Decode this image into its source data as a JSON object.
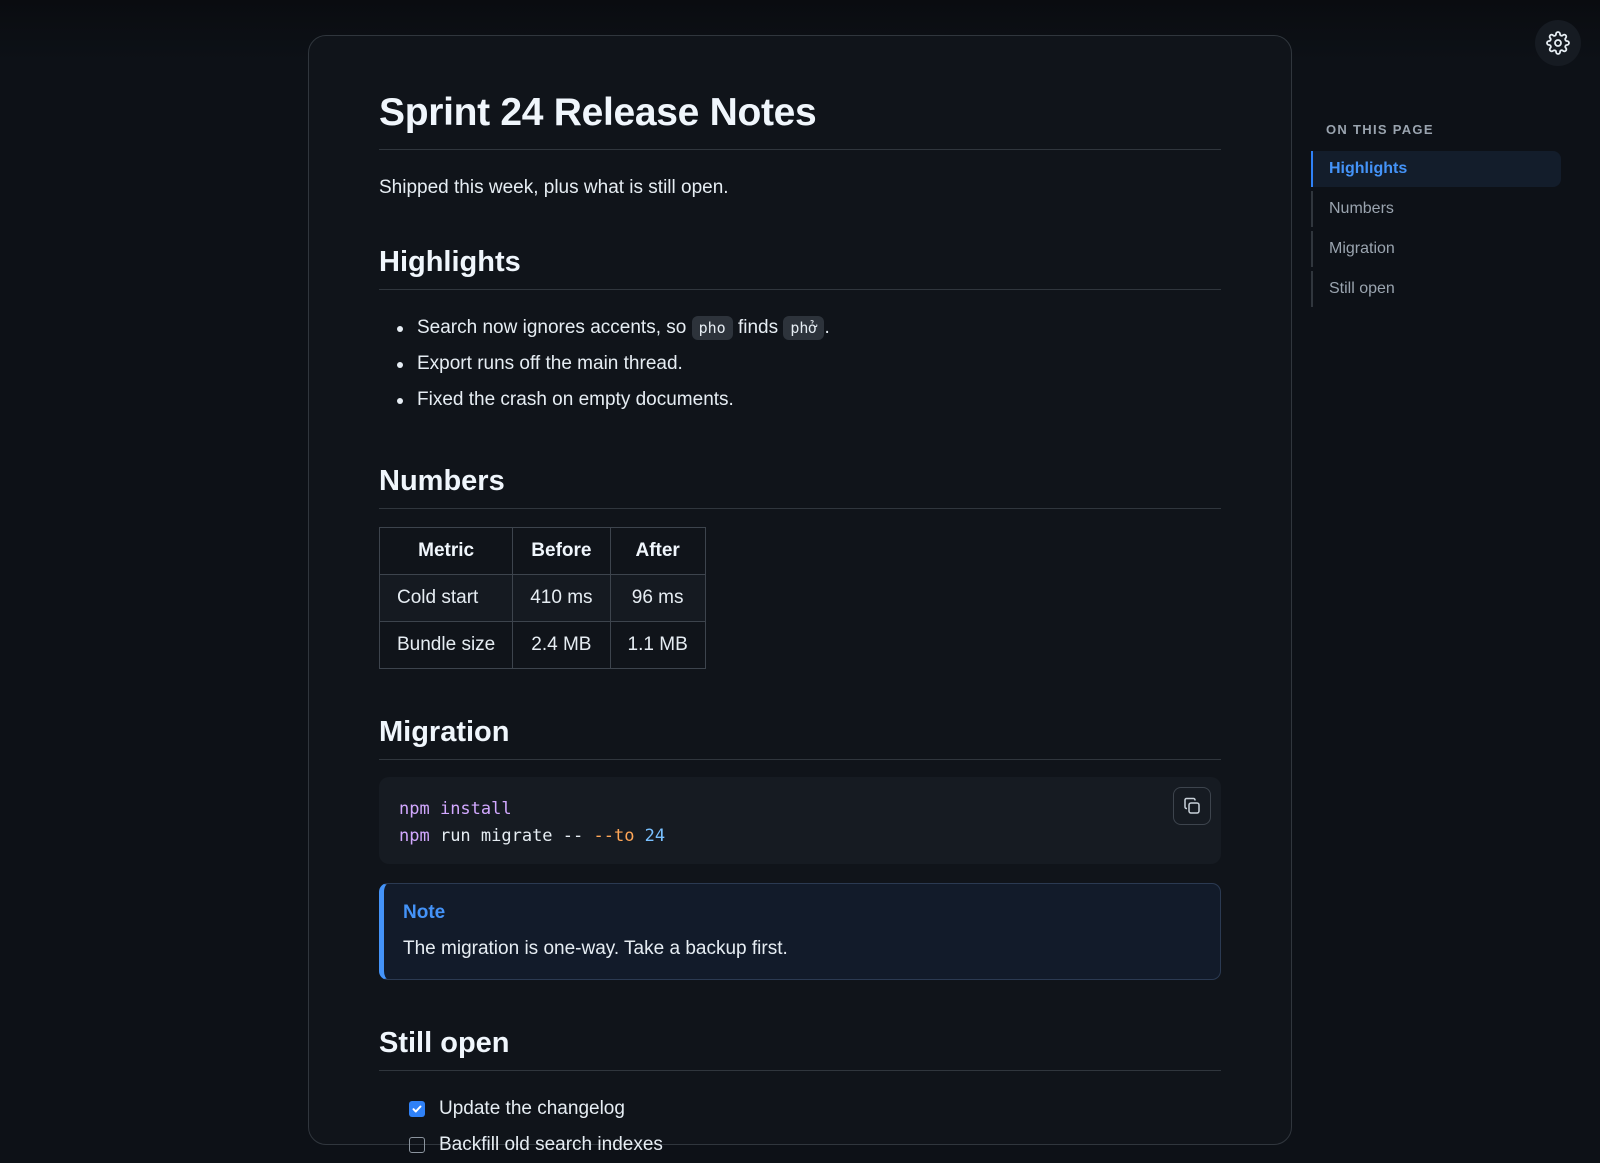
{
  "document": {
    "title": "Sprint 24 Release Notes",
    "lead": "Shipped this week, plus what is still open.",
    "sections": {
      "highlights": {
        "heading": "Highlights",
        "bullet1": {
          "before": "Search now ignores accents, so ",
          "code1": "pho",
          "middle": " finds ",
          "code2": "phở",
          "after": "."
        },
        "bullet2": "Export runs off the main thread.",
        "bullet3": "Fixed the crash on empty documents."
      },
      "numbers": {
        "heading": "Numbers",
        "table": {
          "headers": [
            "Metric",
            "Before",
            "After"
          ],
          "rows": [
            [
              "Cold start",
              "410 ms",
              "96 ms"
            ],
            [
              "Bundle size",
              "2.4 MB",
              "1.1 MB"
            ]
          ]
        }
      },
      "migration": {
        "heading": "Migration",
        "code": {
          "line1": {
            "cmd": "npm",
            "rest": " install"
          },
          "line2": {
            "cmd": "npm",
            "plain": " run migrate -- ",
            "flag": "--to",
            "num": " 24"
          }
        },
        "note": {
          "title": "Note",
          "body": "The migration is one-way. Take a backup first."
        }
      },
      "still_open": {
        "heading": "Still open",
        "tasks": [
          {
            "label": "Update the changelog",
            "checked": true
          },
          {
            "label": "Backfill old search indexes",
            "checked": false
          }
        ]
      }
    }
  },
  "toc": {
    "heading": "ON THIS PAGE",
    "items": [
      "Highlights",
      "Numbers",
      "Migration",
      "Still open"
    ],
    "active": "Highlights"
  },
  "icons": {
    "settings": "gear-icon",
    "copy": "copy-icon",
    "check": "check-icon"
  },
  "colors": {
    "accent": "#4493f8",
    "background": "#0d1117",
    "card": "#10141a"
  }
}
